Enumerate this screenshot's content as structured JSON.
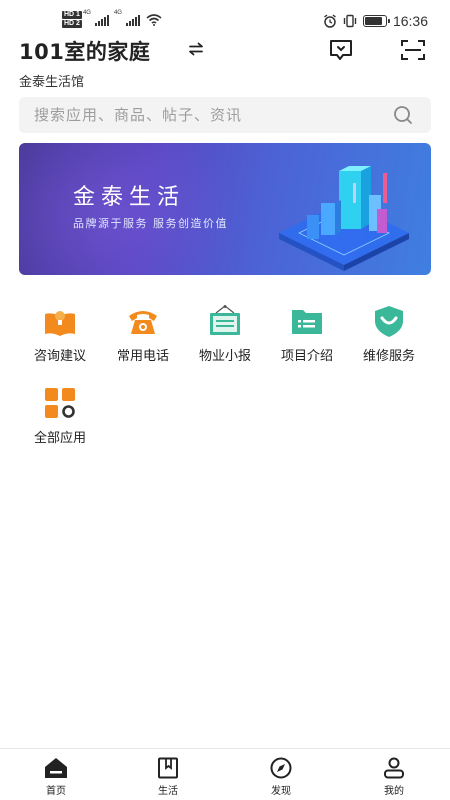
{
  "status_bar": {
    "sim1": "HD 1",
    "sim2": "HD 2",
    "net1": "4G",
    "net2": "4G",
    "time": "16:36",
    "battery_level": 0.85
  },
  "header": {
    "home_title": "101室的家庭",
    "community": "金泰生活馆"
  },
  "search": {
    "placeholder": "搜索应用、商品、帖子、资讯"
  },
  "banner": {
    "title": "金泰生活",
    "subtitle": "品牌源于服务   服务创造价值"
  },
  "apps": [
    {
      "label": "咨询建议",
      "icon": "book-lightbulb-icon",
      "color": "#f28a1e"
    },
    {
      "label": "常用电话",
      "icon": "telephone-icon",
      "color": "#f28a1e"
    },
    {
      "label": "物业小报",
      "icon": "bulletin-board-icon",
      "color": "#3bb89a"
    },
    {
      "label": "项目介绍",
      "icon": "folder-icon",
      "color": "#3bb89a"
    },
    {
      "label": "维修服务",
      "icon": "shield-icon",
      "color": "#3bb89a"
    },
    {
      "label": "全部应用",
      "icon": "all-apps-grid-icon",
      "color": "#f28a1e"
    }
  ],
  "tabbar": {
    "tabs": [
      {
        "label": "首页",
        "icon": "home-icon",
        "active": true
      },
      {
        "label": "生活",
        "icon": "book-icon",
        "active": false
      },
      {
        "label": "发现",
        "icon": "compass-icon",
        "active": false
      },
      {
        "label": "我的",
        "icon": "user-icon",
        "active": false
      }
    ]
  },
  "colors": {
    "accent_orange": "#f28a1e",
    "accent_green": "#3bb89a",
    "banner_start": "#4b3a9a",
    "banner_end": "#3f7fe0"
  }
}
